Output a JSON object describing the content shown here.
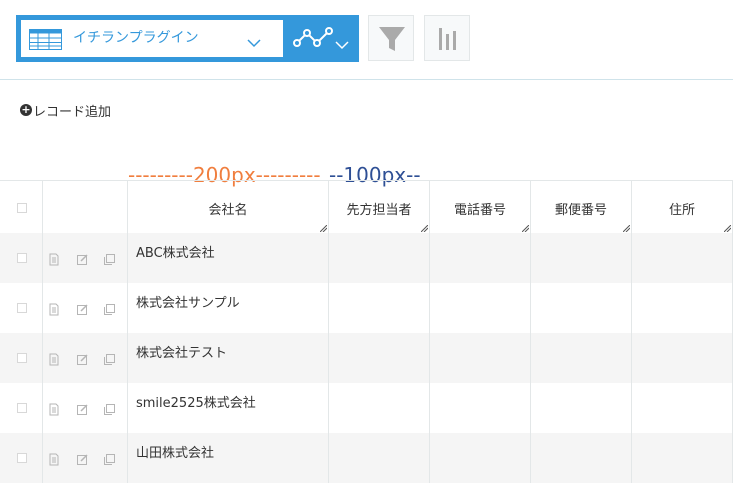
{
  "toolbar": {
    "view_name": "イチランプラグイン"
  },
  "add_record_label": "レコード追加",
  "annotations": {
    "width_200": "---------200px---------",
    "width_100": "--100px--"
  },
  "table": {
    "columns": [
      "会社名",
      "先方担当者",
      "電話番号",
      "郵便番号",
      "住所"
    ],
    "rows": [
      {
        "company": "ABC株式会社"
      },
      {
        "company": "株式会社サンプル"
      },
      {
        "company": "株式会社テスト"
      },
      {
        "company": "smile2525株式会社"
      },
      {
        "company": "山田株式会社"
      }
    ]
  }
}
